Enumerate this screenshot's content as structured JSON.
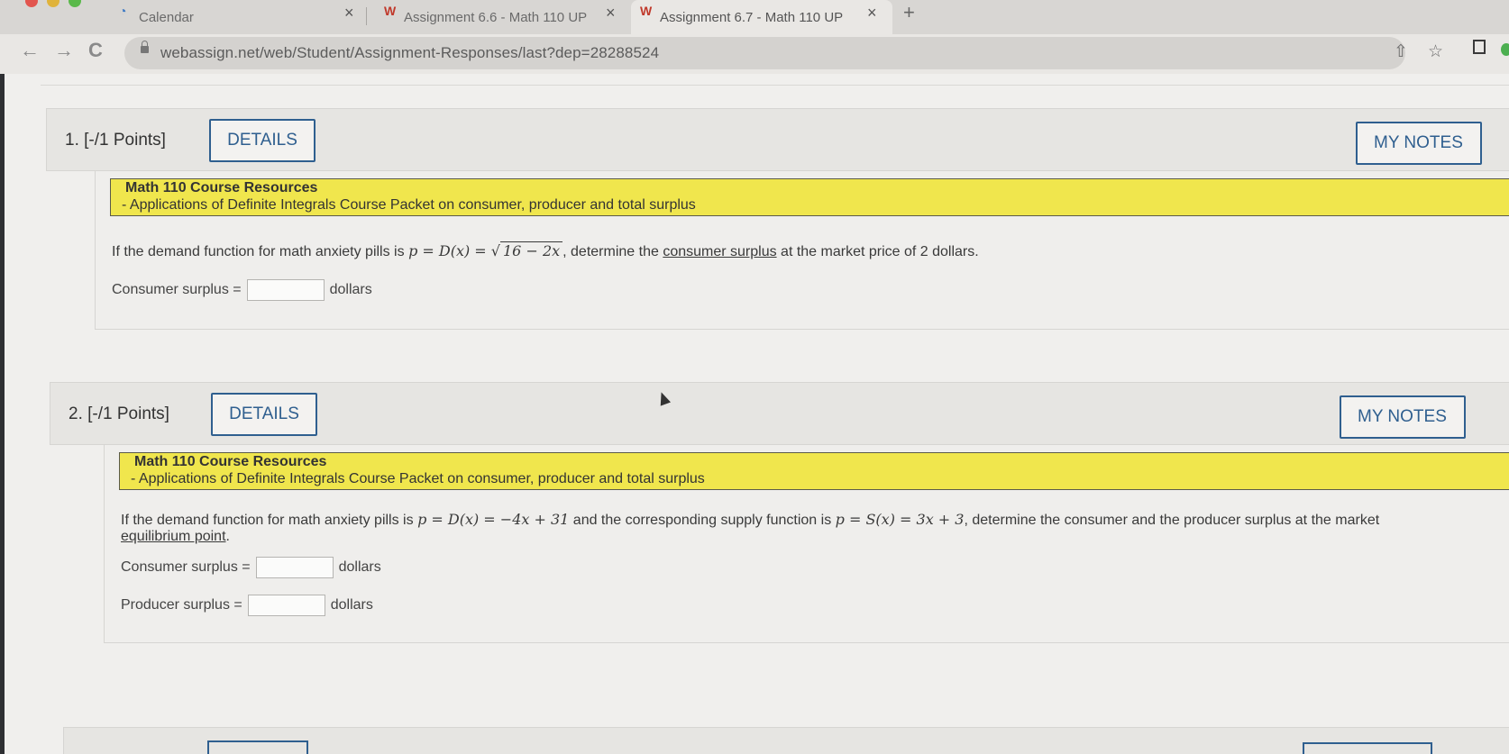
{
  "browser": {
    "tabs": [
      {
        "title": "Calendar",
        "favicon": "calendar-icon",
        "active": false
      },
      {
        "title": "Assignment 6.6 - Math 110 UP",
        "favicon": "webassign-icon",
        "active": false
      },
      {
        "title": "Assignment 6.7 - Math 110 UP",
        "favicon": "webassign-icon",
        "active": true
      }
    ],
    "close_glyph": "×",
    "new_tab_glyph": "+",
    "back_glyph": "←",
    "forward_glyph": "→",
    "reload_glyph": "C",
    "url": "webassign.net/web/Student/Assignment-Responses/last?dep=28288524",
    "share_glyph": "⇧",
    "bookmark_glyph": "☆"
  },
  "questions": [
    {
      "number": "1.",
      "points": "[-/1 Points]",
      "details_label": "DETAILS",
      "notes_label": "MY NOTES",
      "resource_title": "Math 110 Course Resources",
      "resource_link": "- Applications of Definite Integrals Course Packet on consumer, producer and total surplus",
      "text_before": "If the demand function for math anxiety pills is ",
      "formula": "p = D(x) = ",
      "radicand": "16 − 2x",
      "text_after": ", determine the ",
      "term": "consumer surplus",
      "text_end": " at the market price of 2 dollars.",
      "answers": [
        {
          "label": "Consumer surplus =",
          "unit": "dollars",
          "value": ""
        }
      ]
    },
    {
      "number": "2.",
      "points": "[-/1 Points]",
      "details_label": "DETAILS",
      "notes_label": "MY NOTES",
      "resource_title": "Math 110 Course Resources",
      "resource_link": "- Applications of Definite Integrals Course Packet on consumer, producer and total surplus",
      "text_before": "If the demand function for math anxiety pills is ",
      "formula": "p = D(x) = −4x + 31",
      "text_mid": " and the corresponding supply function is ",
      "formula2": "p = S(x) = 3x + 3",
      "text_after": ", determine the consumer and the producer surplus at the market",
      "term": "equilibrium point",
      "text_end": ".",
      "answers": [
        {
          "label": "Consumer surplus =",
          "unit": "dollars",
          "value": ""
        },
        {
          "label": "Producer surplus =",
          "unit": "dollars",
          "value": ""
        }
      ]
    }
  ]
}
